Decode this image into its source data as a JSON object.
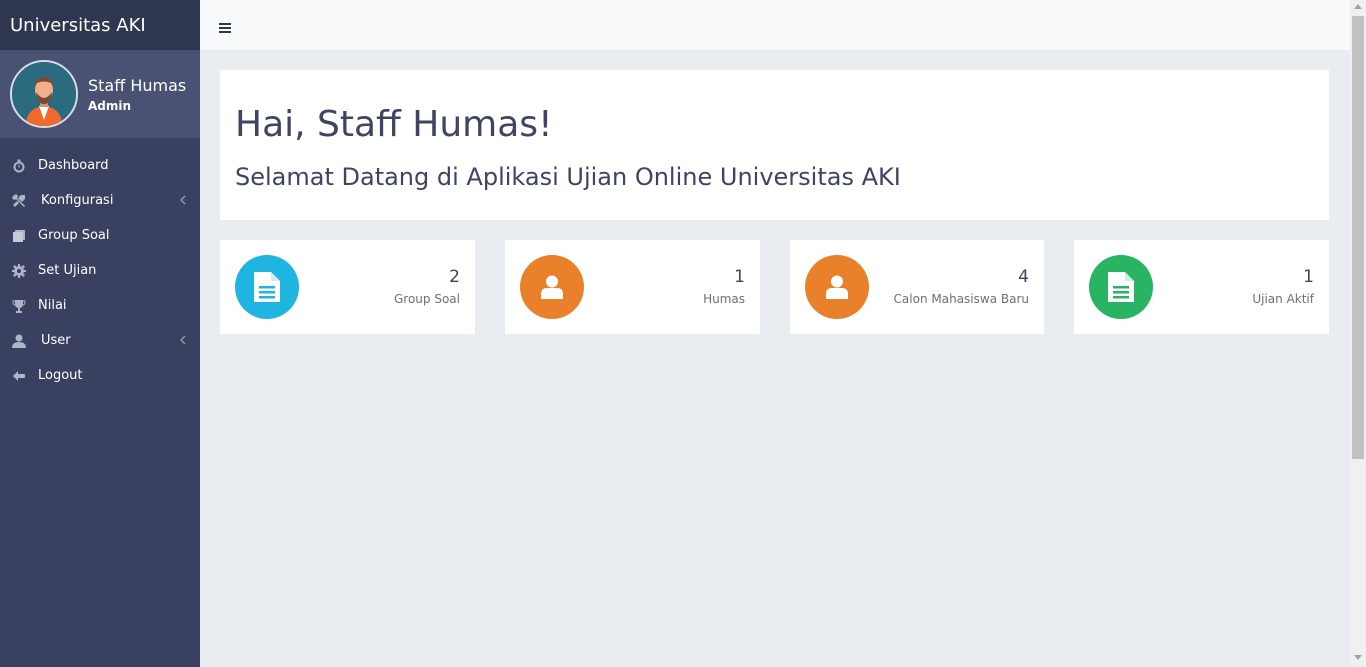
{
  "brand": "Universitas AKI",
  "user": {
    "name": "Staff Humas",
    "role": "Admin"
  },
  "menu": [
    {
      "label": "Dashboard",
      "icon": "stopwatch-icon"
    },
    {
      "label": "Konfigurasi",
      "icon": "wrench-icon",
      "has_submenu": true
    },
    {
      "label": "Group Soal",
      "icon": "copy-icon"
    },
    {
      "label": "Set Ujian",
      "icon": "gear-icon"
    },
    {
      "label": "Nilai",
      "icon": "trophy-icon"
    },
    {
      "label": "User",
      "icon": "user-icon",
      "has_submenu": true
    },
    {
      "label": "Logout",
      "icon": "arrow-left-icon"
    }
  ],
  "welcome": {
    "title": "Hai, Staff Humas!",
    "subtitle": "Selamat Datang di Aplikasi Ujian Online Universitas AKI"
  },
  "stats": [
    {
      "count": "2",
      "label": "Group Soal",
      "icon": "file-icon",
      "color": "#1fb5e0"
    },
    {
      "count": "1",
      "label": "Humas",
      "icon": "user-icon",
      "color": "#e8812a"
    },
    {
      "count": "4",
      "label": "Calon Mahasiswa Baru",
      "icon": "user-icon",
      "color": "#e8812a"
    },
    {
      "count": "1",
      "label": "Ujian Aktif",
      "icon": "file-icon",
      "color": "#28b463"
    }
  ]
}
